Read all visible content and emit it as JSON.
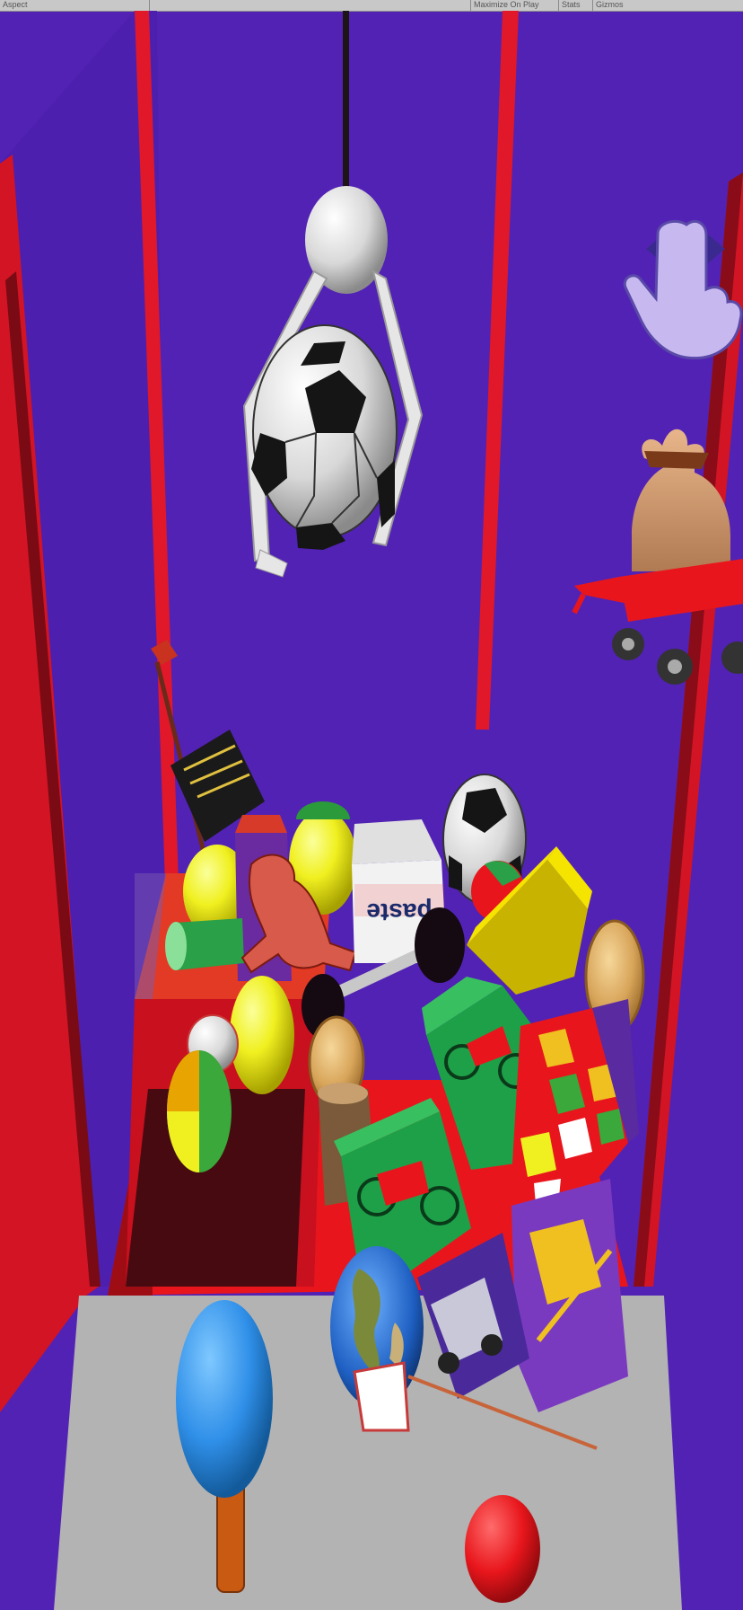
{
  "topbar": {
    "left_text": "Aspect",
    "right_tabs": [
      "Maximize On Play",
      "Stats",
      "Gizmos"
    ]
  },
  "game": {
    "prize_labels": {
      "toothpaste": "paste"
    },
    "icons": {
      "swipe_hint": "hand-swipe-icon",
      "prize_cart": "prize-wagon-icon",
      "joystick": "joystick-icon",
      "drop_button": "drop-button-icon"
    },
    "colors": {
      "background": "#5222b4",
      "frame": "#e0182a",
      "floor": "#b3b3b3",
      "joystick_knob": "#2f8fe8",
      "drop_button": "#e8161c"
    }
  }
}
